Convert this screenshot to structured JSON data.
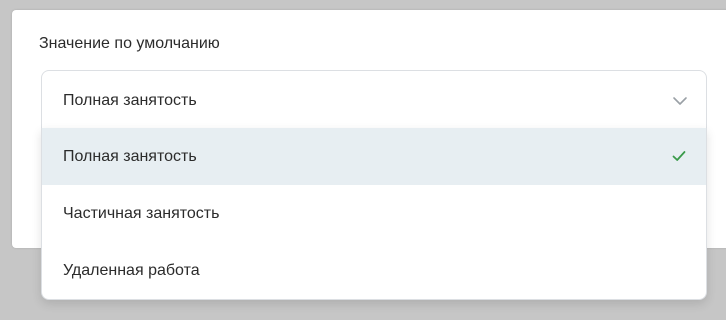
{
  "field": {
    "label": "Значение по умолчанию",
    "selected_value": "Полная занятость"
  },
  "dropdown": {
    "options": [
      {
        "label": "Полная занятость",
        "selected": true
      },
      {
        "label": "Частичная занятость",
        "selected": false
      },
      {
        "label": "Удаленная работа",
        "selected": false
      }
    ]
  },
  "icons": {
    "chevron": "chevron-down-icon",
    "check": "check-icon"
  },
  "colors": {
    "selected_bg": "#e7eef2",
    "check": "#3a9a4a",
    "chevron": "#9aa0a6"
  }
}
